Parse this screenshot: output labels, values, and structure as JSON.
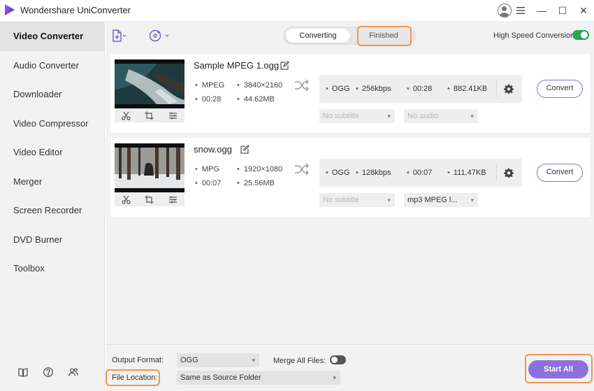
{
  "app": {
    "title": "Wondershare UniConverter"
  },
  "window": {
    "minimize": "—",
    "maximize": "☐",
    "close": "✕"
  },
  "sidebar": {
    "items": [
      {
        "label": "Video Converter",
        "active": true
      },
      {
        "label": "Audio Converter"
      },
      {
        "label": "Downloader"
      },
      {
        "label": "Video Compressor"
      },
      {
        "label": "Video Editor"
      },
      {
        "label": "Merger"
      },
      {
        "label": "Screen Recorder"
      },
      {
        "label": "DVD Burner"
      },
      {
        "label": "Toolbox"
      }
    ],
    "bottom_icons": [
      "book-icon",
      "help-icon",
      "users-icon"
    ]
  },
  "toolbar": {
    "tabs": [
      {
        "label": "Converting",
        "selected": true
      },
      {
        "label": "Finished"
      }
    ],
    "high_speed_label": "High Speed Conversion",
    "high_speed_on": true
  },
  "files": [
    {
      "name": "Sample MPEG 1.ogg",
      "src_format": "MPEG",
      "src_resolution": "3840×2160",
      "src_duration": "00:28",
      "src_size": "44.62MB",
      "out_format": "OGG",
      "out_bitrate": "256kbps",
      "out_duration": "00:28",
      "out_size": "882.41KB",
      "subtitle": "No subtitle",
      "audio": "No audio",
      "audio_enabled": false,
      "convert_label": "Convert"
    },
    {
      "name": "snow.ogg",
      "src_format": "MPG",
      "src_resolution": "1920×1080",
      "src_duration": "00:07",
      "src_size": "25.56MB",
      "out_format": "OGG",
      "out_bitrate": "128kbps",
      "out_duration": "00:07",
      "out_size": "111.47KB",
      "subtitle": "No subtitle",
      "audio": "mp3 MPEG l...",
      "audio_enabled": true,
      "convert_label": "Convert"
    }
  ],
  "footer": {
    "output_format_label": "Output Format:",
    "output_format_value": "OGG",
    "merge_label": "Merge All Files:",
    "merge_on": false,
    "file_location_label": "File Location:",
    "file_location_value": "Same as Source Folder",
    "start_all_label": "Start All"
  },
  "colors": {
    "accent": "#8e6fe0",
    "highlight": "#f29450",
    "toggle_on": "#2aa44f",
    "logo": "#7b3fe4"
  }
}
